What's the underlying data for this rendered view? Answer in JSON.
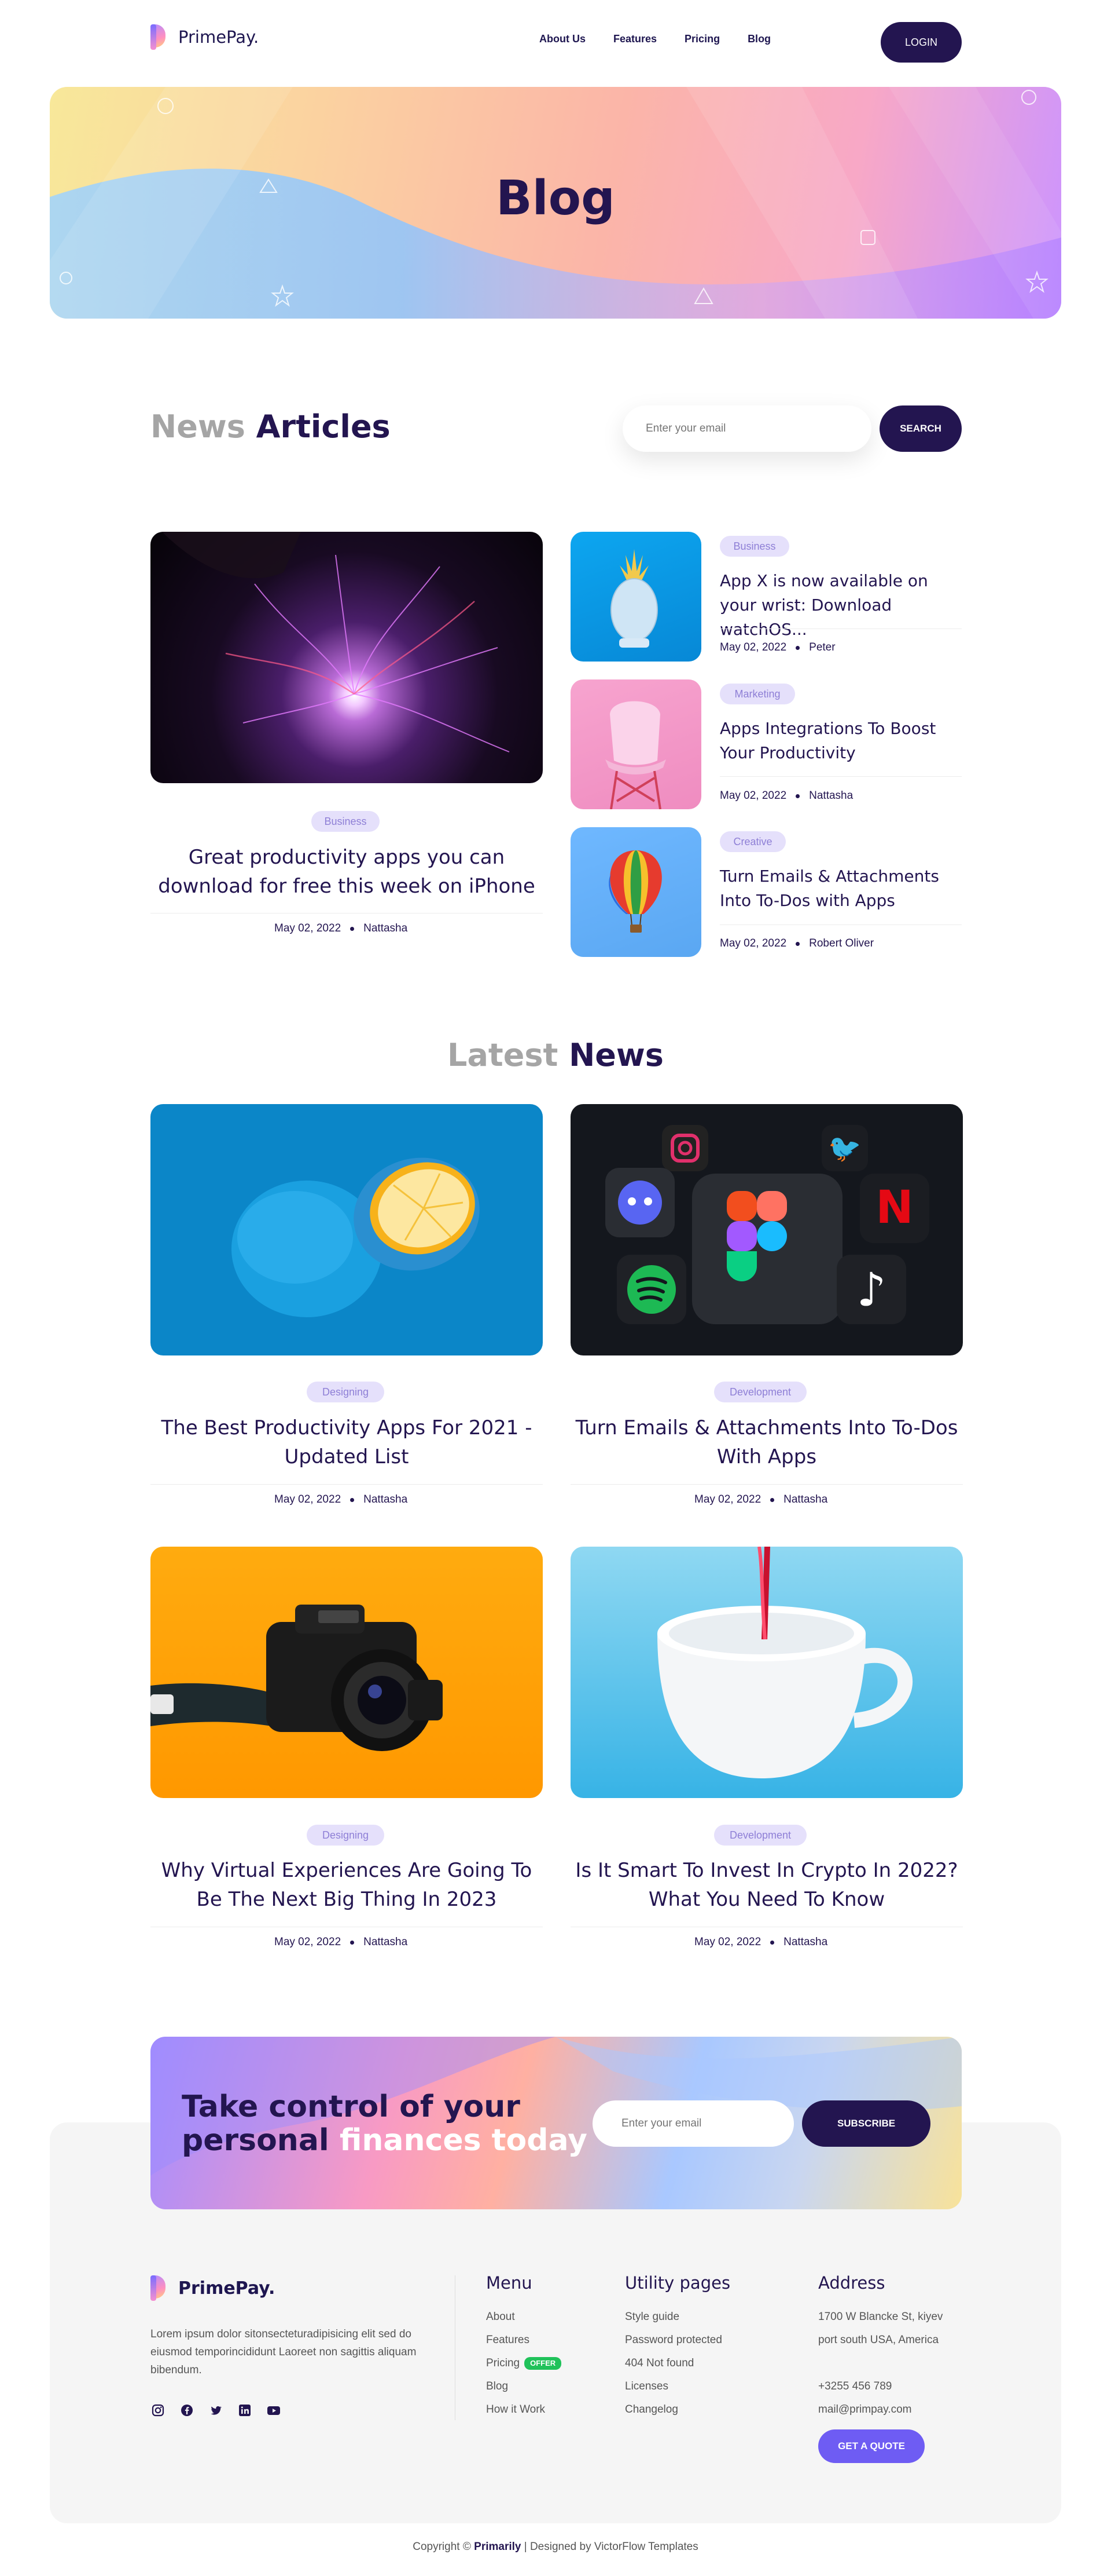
{
  "nav": {
    "logo": "PrimePay.",
    "links": [
      "About Us",
      "Features",
      "Pricing",
      "Blog"
    ],
    "login": "LOGIN"
  },
  "hero": {
    "title": "Blog"
  },
  "articles": {
    "title_light": "News",
    "title_dark": "Articles",
    "search_placeholder": "Enter your email",
    "search_button": "SEARCH",
    "featured": {
      "badge": "Business",
      "title": "Great productivity apps you can download for free this week on iPhone",
      "date": "May 02, 2022",
      "author": "Nattasha"
    },
    "side": [
      {
        "badge": "Business",
        "title": "App X is now available on your wrist: Download watchOS...",
        "date": "May 02, 2022",
        "author": "Peter"
      },
      {
        "badge": "Marketing",
        "title": "Apps Integrations To Boost Your Productivity",
        "date": "May 02, 2022",
        "author": "Nattasha"
      },
      {
        "badge": "Creative",
        "title": "Turn Emails & Attachments Into To-Dos with Apps",
        "date": "May 02, 2022",
        "author": "Robert Oliver"
      }
    ]
  },
  "latest": {
    "title_light": "Latest",
    "title_dark": "News",
    "cards": [
      {
        "badge": "Designing",
        "title": "The Best Productivity Apps For 2021 - Updated List",
        "date": "May 02, 2022",
        "author": "Nattasha"
      },
      {
        "badge": "Development",
        "title": "Turn Emails & Attachments Into To-Dos With Apps",
        "date": "May 02, 2022",
        "author": "Nattasha"
      },
      {
        "badge": "Designing",
        "title": "Why Virtual Experiences Are Going To Be The Next Big Thing In 2023",
        "date": "May 02, 2022",
        "author": "Nattasha"
      },
      {
        "badge": "Development",
        "title": "Is It Smart To Invest In Crypto In 2022? What You Need To Know",
        "date": "May 02, 2022",
        "author": "Nattasha"
      }
    ]
  },
  "cta": {
    "line1": "Take control of your",
    "line2_dark": "personal",
    "line2_light": "finances today",
    "placeholder": "Enter your email",
    "button": "SUBSCRIBE"
  },
  "footer": {
    "logo": "PrimePay.",
    "description": "Lorem ipsum dolor sitonsecteturadipisicing elit sed do eiusmod temporincididunt Laoreet non sagittis aliquam bibendum.",
    "menu": {
      "title": "Menu",
      "items": [
        "About",
        "Features",
        "Pricing",
        "Blog",
        "How it Work"
      ],
      "offer_badge": "OFFER"
    },
    "utility": {
      "title": "Utility pages",
      "items": [
        "Style guide",
        "Password protected",
        "404 Not found",
        "Licenses",
        "Changelog"
      ]
    },
    "address": {
      "title": "Address",
      "line1": "1700 W Blancke St, kiyev",
      "line2": "port south USA, America",
      "phone": "+3255 456 789",
      "email": "mail@primpay.com",
      "button": "GET A QUOTE"
    },
    "copyright_prefix": "Copyright ©",
    "copyright_brand": "Primarily",
    "copyright_suffix": "| Designed by VictorFlow Templates"
  }
}
